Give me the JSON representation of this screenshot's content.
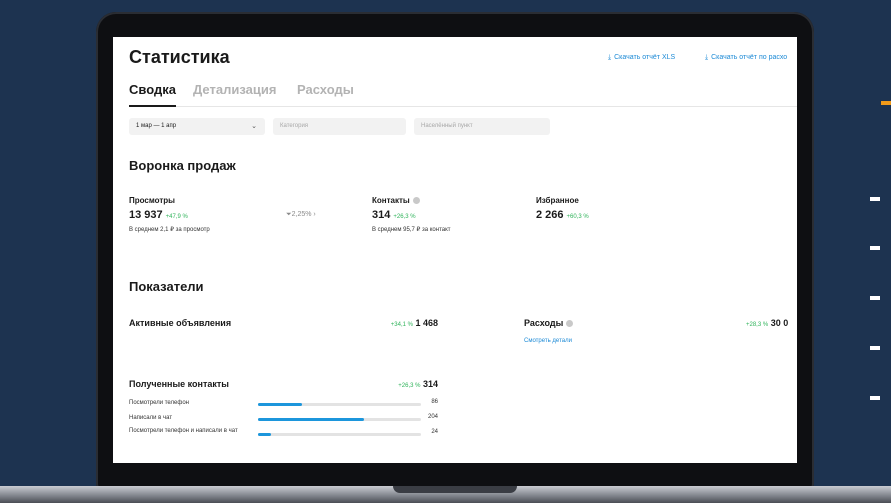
{
  "app": {
    "title": "Статистика",
    "downloads": [
      {
        "icon": "download-icon",
        "label": "Скачать отчёт XLS"
      },
      {
        "icon": "download-icon",
        "label": "Скачать отчёт по расхо"
      }
    ]
  },
  "tabs": [
    {
      "label": "Сводка",
      "active": true
    },
    {
      "label": "Детализация",
      "active": false
    },
    {
      "label": "Расходы",
      "active": false
    }
  ],
  "filters": {
    "period": "1 мар — 1 апр",
    "category_placeholder": "Категория",
    "location_placeholder": "Населённый пункт"
  },
  "funnel": {
    "title": "Воронка продаж",
    "views": {
      "label": "Просмотры",
      "value": "13 937",
      "delta": "+47,9 %",
      "sub": "В среднем 2,1 ₽ за просмотр"
    },
    "conversion": "2,25% ›",
    "contacts": {
      "label": "Контакты",
      "value": "314",
      "delta": "+26,3 %",
      "sub": "В среднем 95,7 ₽ за контакт"
    },
    "favorites": {
      "label": "Избранное",
      "value": "2 266",
      "delta": "+60,3 %"
    }
  },
  "indicators": {
    "title": "Показатели",
    "active_ads": {
      "label": "Активные объявления",
      "delta": "+34,1 %",
      "value": "1 468"
    },
    "expenses": {
      "label": "Расходы",
      "delta": "+28,3 %",
      "value": "30 0",
      "link": "Смотреть детали"
    },
    "contacts_received": {
      "label": "Полученные контакты",
      "delta": "+26,3 %",
      "value": "314",
      "rows": [
        {
          "label": "Посмотрели телефон",
          "value": "86",
          "fraction": 0.27
        },
        {
          "label": "Написали в чат",
          "value": "204",
          "fraction": 0.65
        },
        {
          "label": "Посмотрели телефон и написали в чат",
          "value": "24",
          "fraction": 0.08
        }
      ]
    }
  },
  "colors": {
    "accent": "#1c96dc",
    "positive": "#2fb35a",
    "background": "#1d3350",
    "decor_orange": "#f29b1a"
  }
}
